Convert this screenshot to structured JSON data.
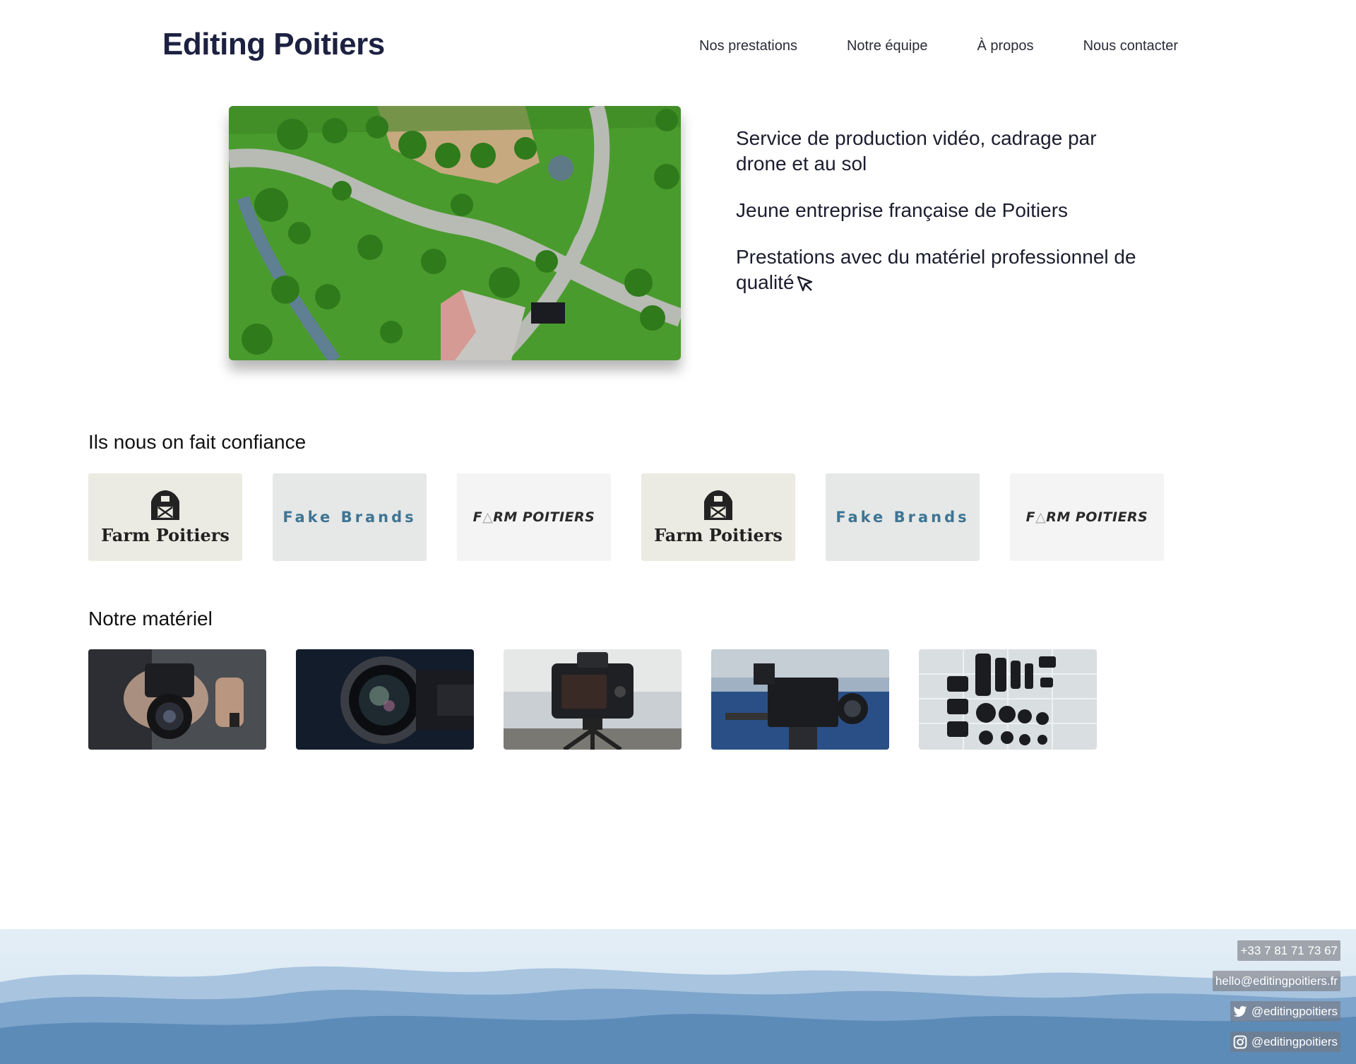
{
  "header": {
    "brand": "Editing Poitiers",
    "nav": [
      "Nos prestations",
      "Notre équipe",
      "À propos",
      "Nous contacter"
    ]
  },
  "hero": {
    "image": "aerial drone view of park with trees and path",
    "lines": [
      "Service de production vidéo, cadrage par drone et au sol",
      "Jeune entreprise française de Poitiers",
      "Prestations avec du matériel professionnel de qualité"
    ]
  },
  "clients": {
    "title": "Ils nous on fait confiance",
    "logos": [
      {
        "name": "Farm Poitiers",
        "icon": "barn-icon"
      },
      {
        "name": "Fake Brands"
      },
      {
        "name_pre": "F",
        "name_tri": "△",
        "name_post": "RM POITIERS"
      },
      {
        "name": "Farm Poitiers",
        "icon": "barn-icon"
      },
      {
        "name": "Fake Brands"
      },
      {
        "name_pre": "F",
        "name_tri": "△",
        "name_post": "RM POITIERS"
      }
    ]
  },
  "equipment": {
    "title": "Notre matériel",
    "photos": [
      "camera-in-hands",
      "lens-closeup",
      "camera-on-tripod",
      "cinema-camera-rig",
      "lens-collection-flatlay"
    ]
  },
  "footer": {
    "phone": "+33 7 81 71 73 67",
    "email": "hello@editingpoitiers.fr",
    "twitter": "@editingpoitiers",
    "instagram": "@editingpoitiers"
  },
  "colors": {
    "brand": "#1d2141",
    "text": "#1b1d2e",
    "fake_brand": "#3f7494",
    "mountain": "#5c8bb8"
  }
}
